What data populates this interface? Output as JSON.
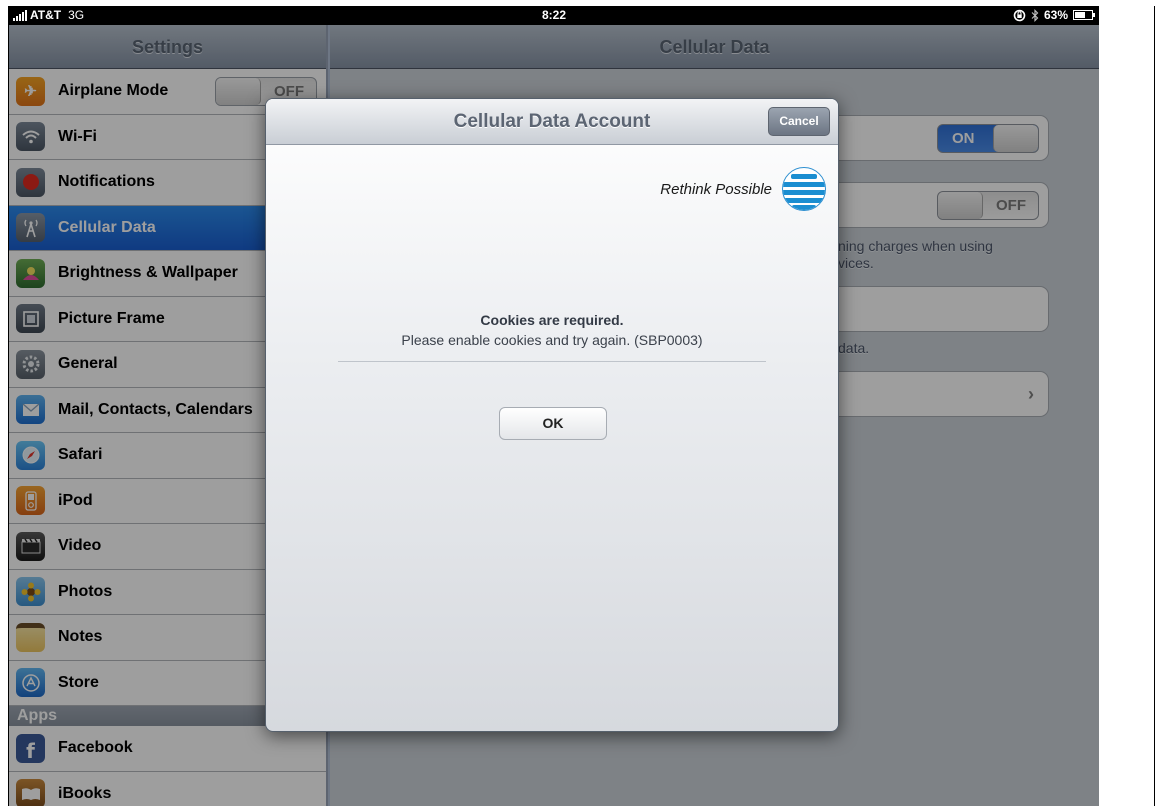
{
  "status_bar": {
    "carrier": "AT&T",
    "network": "3G",
    "time": "8:22",
    "battery": "63%",
    "battery_level": 0.63,
    "icons": [
      "signal-icon",
      "lock-rotation-icon",
      "bluetooth-icon",
      "battery-icon"
    ]
  },
  "sidebar": {
    "title": "Settings",
    "items": [
      {
        "label": "Airplane Mode",
        "icon": "airplane-icon",
        "toggle": "OFF"
      },
      {
        "label": "Wi-Fi",
        "icon": "wifi-icon"
      },
      {
        "label": "Notifications",
        "icon": "notifications-icon"
      },
      {
        "label": "Cellular Data",
        "icon": "cellular-icon",
        "selected": true
      },
      {
        "label": "Brightness & Wallpaper",
        "icon": "brightness-icon"
      },
      {
        "label": "Picture Frame",
        "icon": "picture-frame-icon"
      },
      {
        "label": "General",
        "icon": "gear-icon"
      },
      {
        "label": "Mail, Contacts, Calendars",
        "icon": "mail-icon"
      },
      {
        "label": "Safari",
        "icon": "safari-icon"
      },
      {
        "label": "iPod",
        "icon": "ipod-icon"
      },
      {
        "label": "Video",
        "icon": "video-icon"
      },
      {
        "label": "Photos",
        "icon": "photos-icon"
      },
      {
        "label": "Notes",
        "icon": "notes-icon"
      },
      {
        "label": "Store",
        "icon": "store-icon"
      }
    ],
    "apps_header": "Apps",
    "apps": [
      {
        "label": "Facebook",
        "icon": "facebook-icon"
      },
      {
        "label": "iBooks",
        "icon": "ibooks-icon"
      }
    ]
  },
  "detail": {
    "title": "Cellular Data",
    "toggle1": "ON",
    "toggle2": "OFF",
    "footnote1_line1": "ning charges when using",
    "footnote1_line2": "vices.",
    "footnote2": "data."
  },
  "modal": {
    "title": "Cellular Data Account",
    "cancel_label": "Cancel",
    "brand_tagline": "Rethink Possible",
    "message_title": "Cookies are required.",
    "message_body": "Please enable cookies and try again. (SBP0003)",
    "ok_label": "OK"
  },
  "colors": {
    "selection_blue": "#1a5fd1",
    "toggle_on_blue": "#2f70d6",
    "att_blue": "#1b8ed1"
  }
}
